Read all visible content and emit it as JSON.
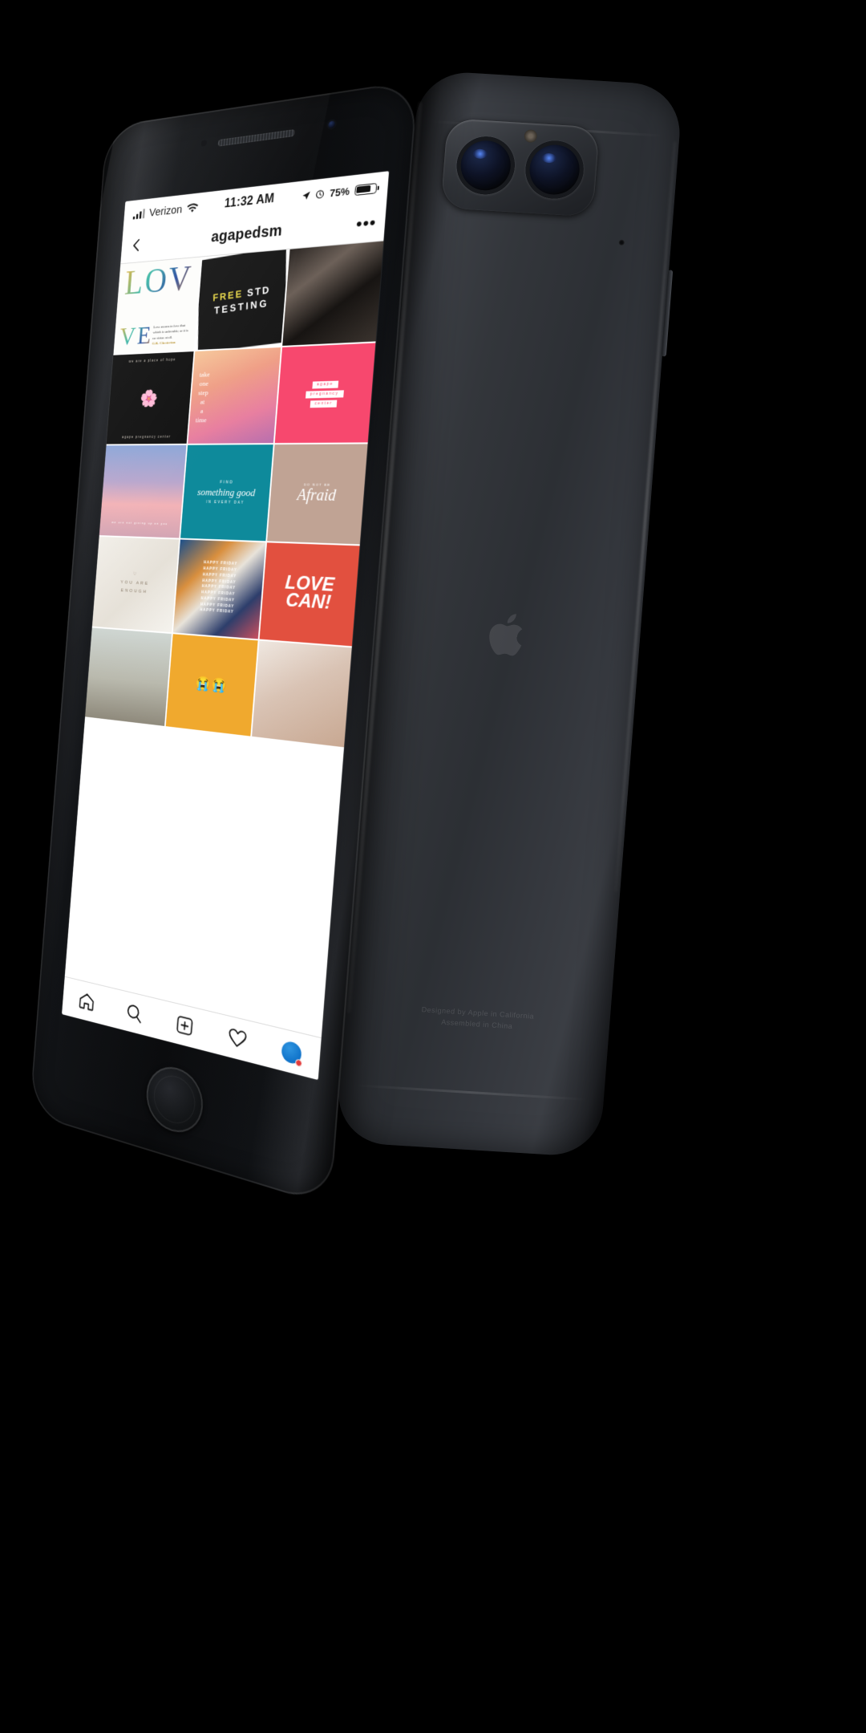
{
  "scene": {
    "description": "iPhone 7 Plus product mockup, front device showing Instagram profile grid, back device showing dual camera"
  },
  "status_bar": {
    "signal_icon": "signal-bars-icon",
    "carrier": "Verizon",
    "wifi_icon": "wifi-icon",
    "time": "11:32 AM",
    "location_icon": "location-arrow-icon",
    "alarm_icon": "alarm-clock-icon",
    "battery_percent": "75%",
    "battery_icon": "battery-icon",
    "battery_level": 75
  },
  "nav_bar": {
    "back_icon": "chevron-left-icon",
    "title": "agapedsm",
    "more_icon": "more-dots-icon",
    "more_label": "•••"
  },
  "grid": {
    "columns": 3,
    "cells": [
      {
        "id": "cell-1",
        "name": "post-love-watercolor",
        "style": "a-love1",
        "big": "LOV",
        "big2": "VE",
        "caption": "Love means to love that which is unlovable; or it is no virtue at all.",
        "attribution": "G.K. Chesterton"
      },
      {
        "id": "cell-2",
        "name": "post-free-std-testing",
        "style": "a-std",
        "line1_highlight": "FREE",
        "line1_rest": "STD",
        "line2": "TESTING"
      },
      {
        "id": "cell-3",
        "name": "post-bw-portrait",
        "style": "a-photo-bw"
      },
      {
        "id": "cell-4",
        "name": "post-place-of-hope",
        "style": "a-dark-floral",
        "top": "we are a place of hope",
        "bottom": "agape pregnancy center"
      },
      {
        "id": "cell-5",
        "name": "post-one-step-at-a-time",
        "style": "a-gradient-face",
        "text": "take one step at a time"
      },
      {
        "id": "cell-6",
        "name": "post-agape-center-pink",
        "style": "a-pink",
        "chips": [
          "agape",
          "pregnancy",
          "center"
        ]
      },
      {
        "id": "cell-7",
        "name": "post-sunset-sky",
        "style": "a-sky",
        "text": "we are not giving up on you"
      },
      {
        "id": "cell-8",
        "name": "post-find-something-good",
        "style": "a-teal",
        "t1": "FIND",
        "t2": "something good",
        "t3": "IN EVERY DAY"
      },
      {
        "id": "cell-9",
        "name": "post-do-not-be-afraid",
        "style": "a-tan",
        "small": "DO NOT BE",
        "script": "Afraid"
      },
      {
        "id": "cell-10",
        "name": "post-you-are-enough",
        "style": "a-white-tex",
        "text": "YOU ARE\nENOUGH"
      },
      {
        "id": "cell-11",
        "name": "post-happy-friday",
        "style": "a-hf",
        "repeat_text": "HAPPY FRIDAY",
        "repeat_count": 9
      },
      {
        "id": "cell-12",
        "name": "post-love-can",
        "style": "a-lovecan",
        "l1": "LOVE",
        "l2": "CAN!"
      },
      {
        "id": "cell-13",
        "name": "post-dandelion",
        "style": "a-dandy"
      },
      {
        "id": "cell-14",
        "name": "post-orange-emoji",
        "style": "a-orange",
        "emoji": "😭😭"
      },
      {
        "id": "cell-15",
        "name": "post-baby-hand",
        "style": "a-baby"
      }
    ]
  },
  "tab_bar": {
    "items": [
      {
        "name": "tab-home",
        "icon": "home-icon",
        "label": "Home"
      },
      {
        "name": "tab-search",
        "icon": "search-icon",
        "label": "Search"
      },
      {
        "name": "tab-add-post",
        "icon": "plus-square-icon",
        "label": "New Post"
      },
      {
        "name": "tab-activity",
        "icon": "heart-icon",
        "label": "Activity"
      },
      {
        "name": "tab-profile",
        "icon": "avatar-icon",
        "label": "Profile",
        "has_badge": true
      }
    ]
  },
  "back_device": {
    "engraving_line1": "Designed by Apple in California",
    "engraving_line2": "Assembled in China",
    "logo_icon": "apple-logo-icon"
  },
  "colors": {
    "accent_yellow": "#e8d84a",
    "accent_pink": "#f7486e",
    "accent_teal": "#0e8a9b",
    "accent_red": "#e2503f",
    "accent_orange": "#f0a92e",
    "ig_divider": "#dbdbdb",
    "text_primary": "#111111",
    "profile_blue": "#0f72c9",
    "badge_red": "#e23b3b"
  }
}
